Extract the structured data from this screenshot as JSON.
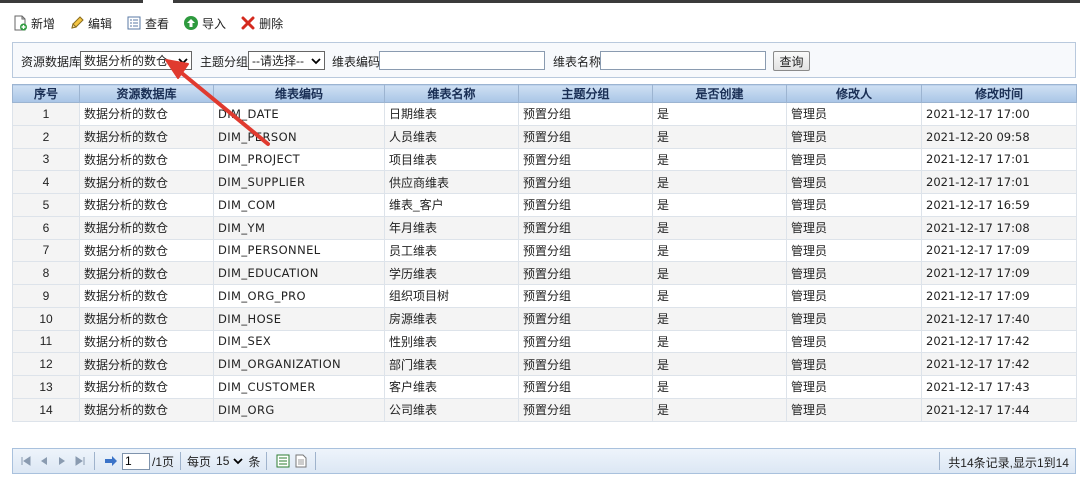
{
  "toolbar": {
    "buttons": [
      {
        "label": "新增",
        "icon": "add-file-icon"
      },
      {
        "label": "编辑",
        "icon": "pencil-icon"
      },
      {
        "label": "查看",
        "icon": "view-list-icon"
      },
      {
        "label": "导入",
        "icon": "import-arrow-icon"
      },
      {
        "label": "删除",
        "icon": "delete-x-icon"
      }
    ]
  },
  "search": {
    "source_db_label": "资源数据库",
    "source_db_value": "数据分析的数仓",
    "subject_label": "主题分组",
    "subject_value": "--请选择--",
    "code_label": "维表编码",
    "code_value": "",
    "name_label": "维表名称",
    "name_value": "",
    "query_label": "查询"
  },
  "table": {
    "headers": [
      "序号",
      "资源数据库",
      "维表编码",
      "维表名称",
      "主题分组",
      "是否创建",
      "修改人",
      "修改时间"
    ],
    "rows": [
      [
        "1",
        "数据分析的数仓",
        "DIM_DATE",
        "日期维表",
        "预置分组",
        "是",
        "管理员",
        "2021-12-17 17:00"
      ],
      [
        "2",
        "数据分析的数仓",
        "DIM_PERSON",
        "人员维表",
        "预置分组",
        "是",
        "管理员",
        "2021-12-20 09:58"
      ],
      [
        "3",
        "数据分析的数仓",
        "DIM_PROJECT",
        "项目维表",
        "预置分组",
        "是",
        "管理员",
        "2021-12-17 17:01"
      ],
      [
        "4",
        "数据分析的数仓",
        "DIM_SUPPLIER",
        "供应商维表",
        "预置分组",
        "是",
        "管理员",
        "2021-12-17 17:01"
      ],
      [
        "5",
        "数据分析的数仓",
        "DIM_COM",
        "维表_客户",
        "预置分组",
        "是",
        "管理员",
        "2021-12-17 16:59"
      ],
      [
        "6",
        "数据分析的数仓",
        "DIM_YM",
        "年月维表",
        "预置分组",
        "是",
        "管理员",
        "2021-12-17 17:08"
      ],
      [
        "7",
        "数据分析的数仓",
        "DIM_PERSONNEL",
        "员工维表",
        "预置分组",
        "是",
        "管理员",
        "2021-12-17 17:09"
      ],
      [
        "8",
        "数据分析的数仓",
        "DIM_EDUCATION",
        "学历维表",
        "预置分组",
        "是",
        "管理员",
        "2021-12-17 17:09"
      ],
      [
        "9",
        "数据分析的数仓",
        "DIM_ORG_PRO",
        "组织项目树",
        "预置分组",
        "是",
        "管理员",
        "2021-12-17 17:09"
      ],
      [
        "10",
        "数据分析的数仓",
        "DIM_HOSE",
        "房源维表",
        "预置分组",
        "是",
        "管理员",
        "2021-12-17 17:40"
      ],
      [
        "11",
        "数据分析的数仓",
        "DIM_SEX",
        "性别维表",
        "预置分组",
        "是",
        "管理员",
        "2021-12-17 17:42"
      ],
      [
        "12",
        "数据分析的数仓",
        "DIM_ORGANIZATION",
        "部门维表",
        "预置分组",
        "是",
        "管理员",
        "2021-12-17 17:42"
      ],
      [
        "13",
        "数据分析的数仓",
        "DIM_CUSTOMER",
        "客户维表",
        "预置分组",
        "是",
        "管理员",
        "2021-12-17 17:43"
      ],
      [
        "14",
        "数据分析的数仓",
        "DIM_ORG",
        "公司维表",
        "预置分组",
        "是",
        "管理员",
        "2021-12-17 17:44"
      ]
    ]
  },
  "pager": {
    "page_value": "1",
    "page_total": "/1页",
    "per_page_label": "每页",
    "per_page_value": "15",
    "per_page_unit": "条",
    "summary": "共14条记录,显示1到14"
  },
  "colors": {
    "header_bg": "#a9c5e6",
    "arrow": "#e03a2f",
    "delete_red": "#d42a1e",
    "import_green": "#2e9a3e"
  }
}
